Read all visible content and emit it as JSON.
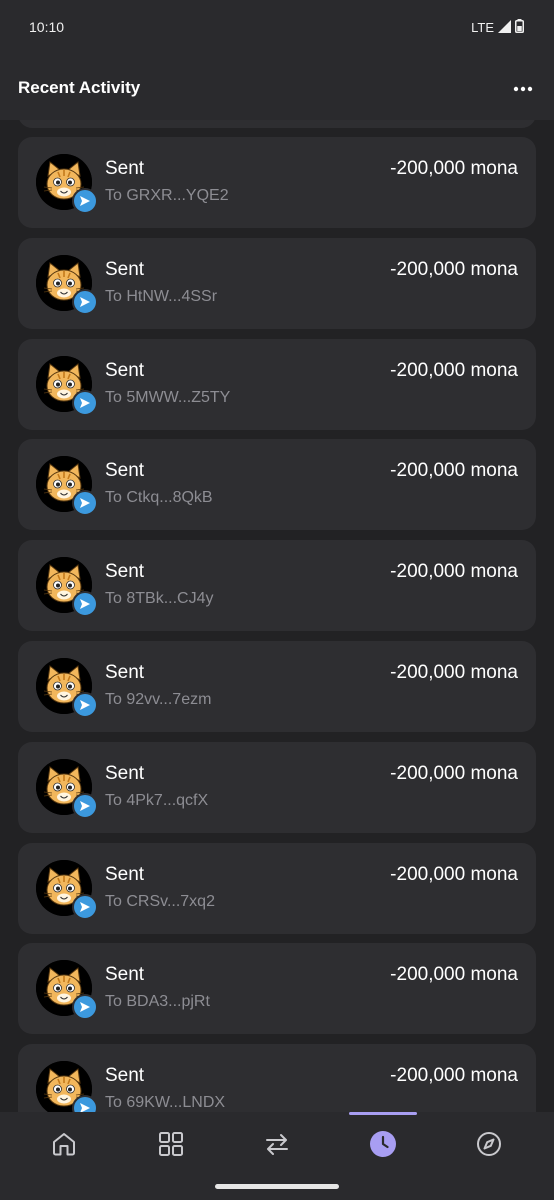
{
  "status_bar": {
    "time": "10:10",
    "network": "LTE"
  },
  "header": {
    "title": "Recent Activity",
    "more_icon": "more-horizontal-icon"
  },
  "transactions": [
    {
      "type": "Sent",
      "to": "To GRXR...YQE2",
      "amount": "-200,000 mona"
    },
    {
      "type": "Sent",
      "to": "To HtNW...4SSr",
      "amount": "-200,000 mona"
    },
    {
      "type": "Sent",
      "to": "To 5MWW...Z5TY",
      "amount": "-200,000 mona"
    },
    {
      "type": "Sent",
      "to": "To Ctkq...8QkB",
      "amount": "-200,000 mona"
    },
    {
      "type": "Sent",
      "to": "To 8TBk...CJ4y",
      "amount": "-200,000 mona"
    },
    {
      "type": "Sent",
      "to": "To 92vv...7ezm",
      "amount": "-200,000 mona"
    },
    {
      "type": "Sent",
      "to": "To 4Pk7...qcfX",
      "amount": "-200,000 mona"
    },
    {
      "type": "Sent",
      "to": "To CRSv...7xq2",
      "amount": "-200,000 mona"
    },
    {
      "type": "Sent",
      "to": "To BDA3...pjRt",
      "amount": "-200,000 mona"
    },
    {
      "type": "Sent",
      "to": "To 69KW...LNDX",
      "amount": "-200,000 mona"
    }
  ],
  "bottom_nav": {
    "items": [
      {
        "icon": "home-icon",
        "active": false
      },
      {
        "icon": "grid-icon",
        "active": false
      },
      {
        "icon": "swap-icon",
        "active": false
      },
      {
        "icon": "clock-icon",
        "active": true
      },
      {
        "icon": "compass-icon",
        "active": false
      }
    ]
  },
  "colors": {
    "background": "#222224",
    "card": "#2e2e31",
    "secondary_text": "#8d8d93",
    "badge_blue": "#3c99de",
    "active_accent": "#a89ef2"
  }
}
